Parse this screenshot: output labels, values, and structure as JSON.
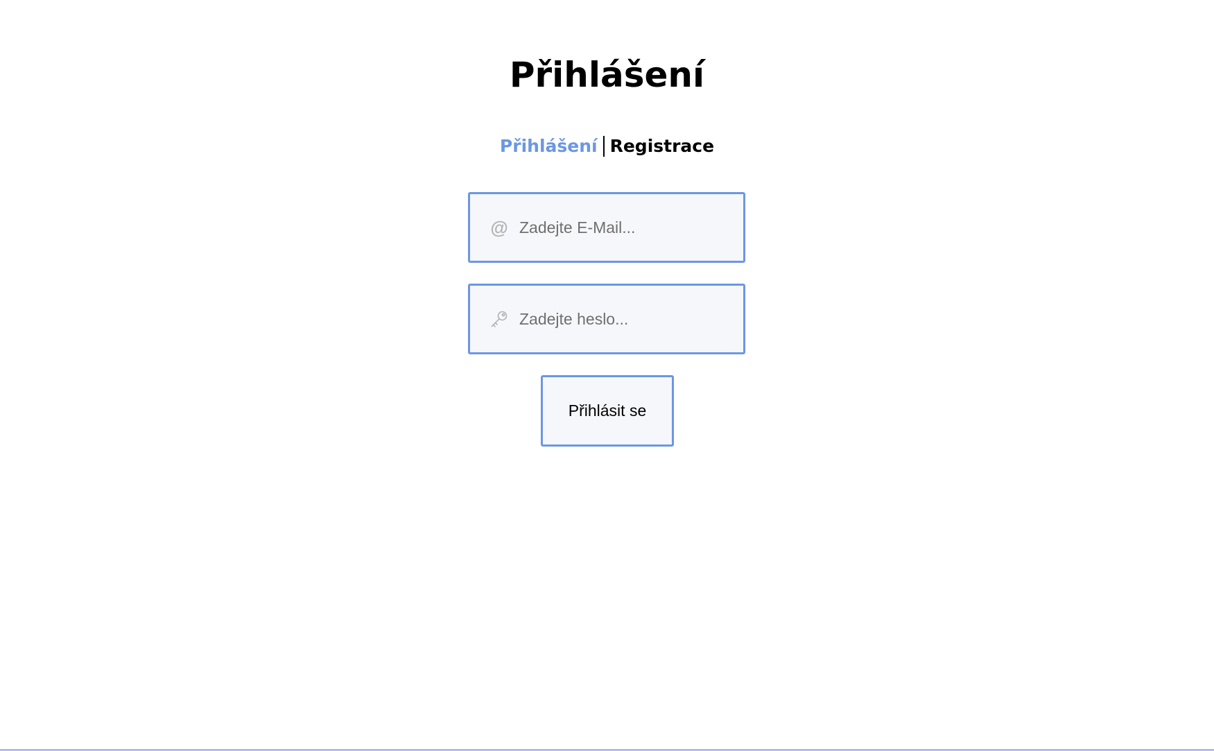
{
  "page": {
    "title": "Přihlášení"
  },
  "tabs": {
    "login_label": "Přihlášení",
    "register_label": "Registrace"
  },
  "form": {
    "email": {
      "icon": "at-icon",
      "placeholder": "Zadejte E-Mail...",
      "value": ""
    },
    "password": {
      "icon": "key-icon",
      "placeholder": "Zadejte heslo...",
      "value": ""
    },
    "submit_label": "Přihlásit se"
  },
  "colors": {
    "accent": "#6b97e2",
    "field_background": "#f5f7fb",
    "icon": "#b3b3b3",
    "text": "#000000"
  }
}
